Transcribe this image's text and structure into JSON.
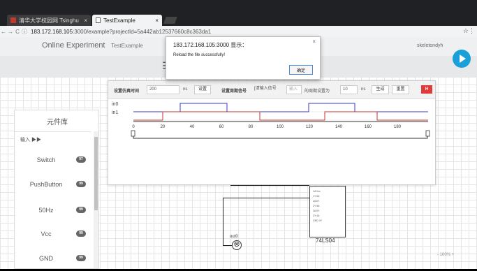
{
  "browser": {
    "tabs": [
      {
        "label": "清华大学校园网 Tsinghu",
        "close": "×"
      },
      {
        "label": "TestExample",
        "close": "×"
      }
    ],
    "url_host": "183.172.168.105",
    "url_rest": ":3000/example?projectId=5a442ab12537660c8c363da1",
    "nav_back": "←",
    "nav_forward": "→",
    "nav_reload": "C",
    "star": "☆",
    "menu": "⋮"
  },
  "app": {
    "name": "Online Experiment",
    "project": "TestExample",
    "user": "skeletondyh",
    "menu_icon": "☰"
  },
  "dialog": {
    "title": "183.172.168.105:3000 显示：",
    "message": "Reload the file successfully!",
    "ok": "确定",
    "close": "×"
  },
  "simulation": {
    "sim_time_label": "设置仿真时间",
    "sim_time_value": "200",
    "sim_unit": "ns",
    "sim_set": "设置",
    "period_label": "设置周期信号",
    "period_placeholder": "[请输入信号",
    "input_placeholder": "输入",
    "period_set_label": "的周期设置为",
    "period_value": "10",
    "period_unit": "ns",
    "generate": "生成",
    "reset": "重置",
    "red_button": "H",
    "signals": [
      "in0",
      "in1"
    ],
    "axis_ticks": [
      "0",
      "20",
      "40",
      "60",
      "80",
      "100",
      "120",
      "140",
      "160",
      "180"
    ]
  },
  "library": {
    "title": "元件库",
    "inputs_header": "输入 ▶▶",
    "items": [
      {
        "name": "Switch",
        "count": "97"
      },
      {
        "name": "PushButton",
        "count": "99"
      },
      {
        "name": "50Hz",
        "count": "99"
      },
      {
        "name": "Vcc",
        "count": "99"
      },
      {
        "name": "GND",
        "count": "99"
      }
    ]
  },
  "circuit": {
    "chip_name": "74LS04",
    "chip_pins": [
      "1A   Vcc",
      "1Y   6A",
      "2A   6Y",
      "2Y   5A",
      "3A   5Y",
      "3Y   4A",
      "GND  4Y"
    ],
    "output_label": "out0",
    "output_symbol": "⊗"
  },
  "zoom": "-  100%  +"
}
